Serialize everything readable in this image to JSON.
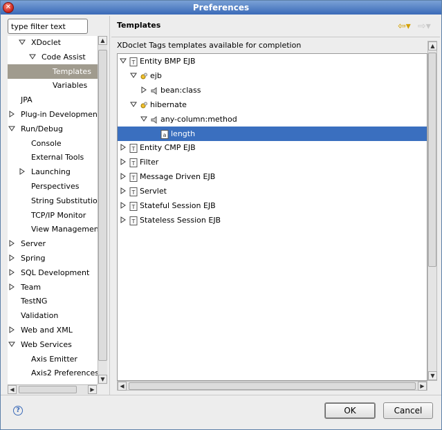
{
  "window": {
    "title": "Preferences"
  },
  "filter": {
    "value": "type filter text"
  },
  "left_tree": [
    {
      "label": "XDoclet",
      "expander": "open"
    },
    {
      "label": "Code Assist",
      "expander": "open"
    },
    {
      "label": "Templates",
      "expander": "none",
      "selected": true
    },
    {
      "label": "Variables",
      "expander": "none"
    },
    {
      "label": "JPA",
      "expander": "none"
    },
    {
      "label": "Plug-in Development",
      "expander": "closed"
    },
    {
      "label": "Run/Debug",
      "expander": "open"
    },
    {
      "label": "Console",
      "expander": "none"
    },
    {
      "label": "External Tools",
      "expander": "none"
    },
    {
      "label": "Launching",
      "expander": "closed"
    },
    {
      "label": "Perspectives",
      "expander": "none"
    },
    {
      "label": "String Substitution",
      "expander": "none"
    },
    {
      "label": "TCP/IP Monitor",
      "expander": "none"
    },
    {
      "label": "View Management",
      "expander": "none"
    },
    {
      "label": "Server",
      "expander": "closed"
    },
    {
      "label": "Spring",
      "expander": "closed"
    },
    {
      "label": "SQL Development",
      "expander": "closed"
    },
    {
      "label": "Team",
      "expander": "closed"
    },
    {
      "label": "TestNG",
      "expander": "none"
    },
    {
      "label": "Validation",
      "expander": "none"
    },
    {
      "label": "Web and XML",
      "expander": "closed"
    },
    {
      "label": "Web Services",
      "expander": "open"
    },
    {
      "label": "Axis Emitter",
      "expander": "none"
    },
    {
      "label": "Axis2 Preferences",
      "expander": "none"
    }
  ],
  "page": {
    "title": "Templates",
    "description": "XDoclet Tags templates available for completion"
  },
  "template_tree": [
    {
      "label": "Entity BMP EJB",
      "expander": "open",
      "icon": "tag-doc-icon"
    },
    {
      "label": "ejb",
      "expander": "open",
      "icon": "namespace-icon"
    },
    {
      "label": "bean:class",
      "expander": "closed",
      "icon": "speaker-tag-icon"
    },
    {
      "label": "hibernate",
      "expander": "open",
      "icon": "namespace-icon"
    },
    {
      "label": "any-column:method",
      "expander": "open",
      "icon": "speaker-tag-icon"
    },
    {
      "label": "length",
      "expander": "none",
      "icon": "attribute-icon",
      "selected": true
    },
    {
      "label": "Entity CMP EJB",
      "expander": "closed",
      "icon": "tag-doc-icon"
    },
    {
      "label": "Filter",
      "expander": "closed",
      "icon": "tag-doc-icon"
    },
    {
      "label": "Message Driven EJB",
      "expander": "closed",
      "icon": "tag-doc-icon"
    },
    {
      "label": "Servlet",
      "expander": "closed",
      "icon": "tag-doc-icon"
    },
    {
      "label": "Stateful Session EJB",
      "expander": "closed",
      "icon": "tag-doc-icon"
    },
    {
      "label": "Stateless Session EJB",
      "expander": "closed",
      "icon": "tag-doc-icon"
    }
  ],
  "buttons": {
    "ok": "OK",
    "cancel": "Cancel"
  },
  "colors": {
    "selection_left": "#a09b8e",
    "selection_right": "#3a6fbf",
    "titlebar": "#3a6ab8"
  }
}
